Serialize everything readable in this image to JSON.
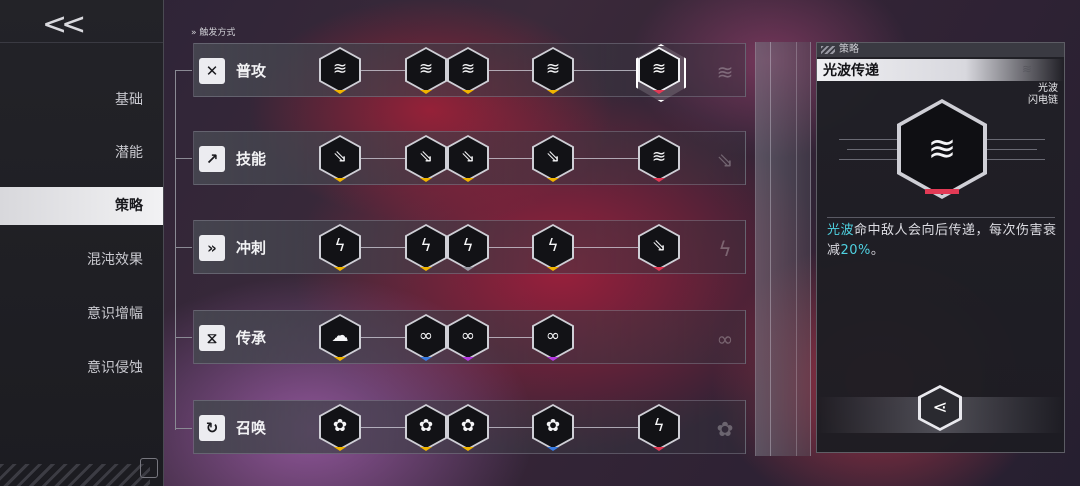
{
  "sidebar": {
    "back_label": "<<",
    "items": [
      {
        "label": "基础",
        "active": false
      },
      {
        "label": "潜能",
        "active": false
      },
      {
        "label": "策略",
        "active": true
      },
      {
        "label": "混沌效果",
        "active": false
      },
      {
        "label": "意识增幅",
        "active": false
      },
      {
        "label": "意识侵蚀",
        "active": false
      }
    ]
  },
  "trigger_header": "触发方式",
  "rows": [
    {
      "label": "普攻",
      "icon": "crossed-swords-icon",
      "nodes": [
        {
          "icon": "light-wave-icon",
          "chevron": "#f0b400"
        },
        {
          "icon": "light-wave-icon",
          "chevron": "#f0b400"
        },
        {
          "icon": "light-wave-icon",
          "chevron": "#f0b400"
        },
        {
          "icon": "light-wave-icon",
          "chevron": "#f0b400"
        },
        {
          "icon": "light-wave-icon",
          "chevron": "#e23a55",
          "selected": true
        }
      ]
    },
    {
      "label": "技能",
      "icon": "arrow-burst-icon",
      "nodes": [
        {
          "icon": "spear-icon",
          "chevron": "#f0b400"
        },
        {
          "icon": "spear-icon",
          "chevron": "#f0b400"
        },
        {
          "icon": "spear-icon",
          "chevron": "#f0b400"
        },
        {
          "icon": "spear-icon",
          "chevron": "#f0b400"
        },
        {
          "icon": "light-wave-icon",
          "chevron": "#e23a55"
        }
      ]
    },
    {
      "label": "冲刺",
      "icon": "dash-icon",
      "nodes": [
        {
          "icon": "lightning-icon",
          "chevron": "#f0b400"
        },
        {
          "icon": "lightning-icon",
          "chevron": "#f0b400"
        },
        {
          "icon": "lightning-icon",
          "chevron": "#9a9aa4"
        },
        {
          "icon": "lightning-icon",
          "chevron": "#f0b400"
        },
        {
          "icon": "spear-icon",
          "chevron": "#e23a55"
        }
      ]
    },
    {
      "label": "传承",
      "icon": "dna-icon",
      "nodes": [
        {
          "icon": "storm-cloud-icon",
          "chevron": "#f0b400"
        },
        {
          "icon": "chain-nodes-icon",
          "chevron": "#3a7be0"
        },
        {
          "icon": "chain-nodes-icon",
          "chevron": "#b43ae0"
        },
        {
          "icon": "chain-nodes-icon",
          "chevron": "#b43ae0"
        }
      ]
    },
    {
      "label": "召唤",
      "icon": "summon-swirl-icon",
      "nodes": [
        {
          "icon": "flower-icon",
          "chevron": "#f0b400"
        },
        {
          "icon": "flower-icon",
          "chevron": "#f0b400"
        },
        {
          "icon": "flower-icon",
          "chevron": "#f0b400"
        },
        {
          "icon": "flower-icon",
          "chevron": "#3a7be0"
        },
        {
          "icon": "lightning-icon",
          "chevron": "#e23a55"
        }
      ]
    }
  ],
  "panel": {
    "header": "策略",
    "title": "光波传递",
    "tag_line1": "光波",
    "tag_line2": "闪电链",
    "icon": "light-wave-icon",
    "desc_keyword": "光波",
    "desc_part1": "命中敌人会向后传递，每次伤害衰减",
    "desc_percent": "20%",
    "desc_end": "。",
    "share_icon": "share-icon"
  }
}
